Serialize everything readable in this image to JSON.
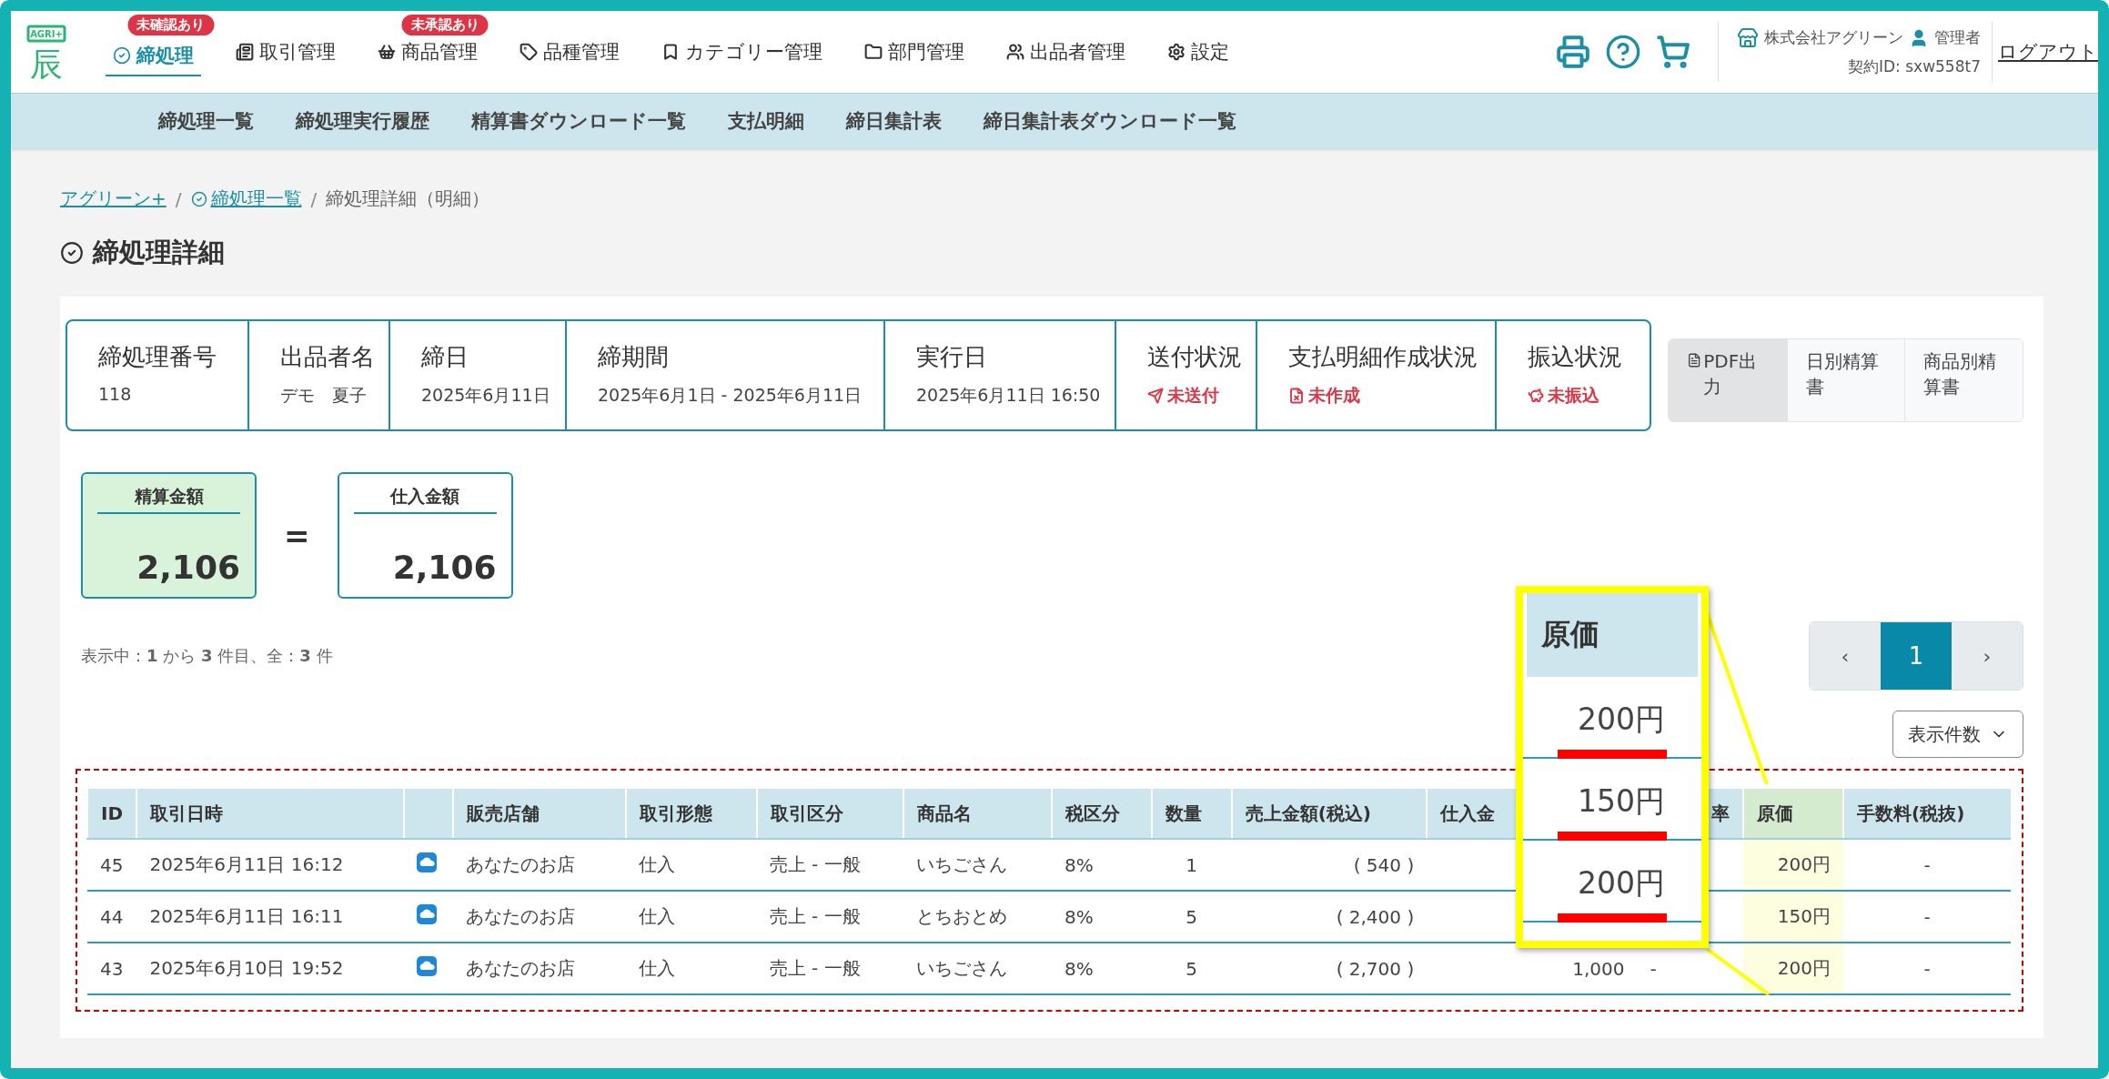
{
  "logo": {
    "top": "AGRI+",
    "bottom": "辰"
  },
  "nav": [
    {
      "label": "締処理",
      "selected": true,
      "badge": "未確認あり"
    },
    {
      "label": "取引管理",
      "selected": false
    },
    {
      "label": "商品管理",
      "selected": false,
      "badge": "未承認あり"
    },
    {
      "label": "品種管理",
      "selected": false
    },
    {
      "label": "カテゴリー管理",
      "selected": false
    },
    {
      "label": "部門管理",
      "selected": false
    },
    {
      "label": "出品者管理",
      "selected": false
    },
    {
      "label": "設定",
      "selected": false
    }
  ],
  "account": {
    "company": "株式会社アグリーン",
    "role": "管理者",
    "contract": "契約ID: sxw558t7",
    "logout": "ログアウト"
  },
  "subnav": [
    "締処理一覧",
    "締処理実行履歴",
    "精算書ダウンロード一覧",
    "支払明細",
    "締日集計表",
    "締日集計表ダウンロード一覧"
  ],
  "breadcrumb": [
    {
      "label": "アグリーン+",
      "link": true
    },
    {
      "label": "締処理一覧",
      "link": true
    },
    {
      "label": "締処理詳細（明細）",
      "link": false
    }
  ],
  "breadcrumb_separator": "/",
  "title": "締処理詳細",
  "info": [
    {
      "label": "締処理番号",
      "value": "118",
      "kind": "plain"
    },
    {
      "label": "出品者名",
      "value": "デモ　夏子",
      "kind": "plain"
    },
    {
      "label": "締日",
      "value": "2025年6月11日",
      "kind": "plain"
    },
    {
      "label": "締期間",
      "value": "2025年6月1日 - 2025年6月11日",
      "kind": "plain"
    },
    {
      "label": "実行日",
      "value": "2025年6月11日 16:50",
      "kind": "plain"
    },
    {
      "label": "送付状況",
      "value": "未送付",
      "kind": "alert"
    },
    {
      "label": "支払明細作成状況",
      "value": "未作成",
      "kind": "alert"
    },
    {
      "label": "振込状況",
      "value": "未振込",
      "kind": "alert"
    }
  ],
  "actions": [
    {
      "label": "PDF出力",
      "selected": true
    },
    {
      "label": "日別精算書",
      "selected": false
    },
    {
      "label": "商品別精算書",
      "selected": false
    }
  ],
  "summary": [
    {
      "label": "精算金額",
      "value": "2,106",
      "kind": "highlight"
    },
    {
      "label": "仕入金額",
      "value": "2,106",
      "kind": "plain"
    }
  ],
  "summary_operator": "=",
  "count_text": "表示中：**1** から **3** 件目、全：**3** 件",
  "pagination": {
    "prev": "‹",
    "pages": [
      {
        "label": "1",
        "selected": true
      }
    ],
    "next": "›"
  },
  "page_size": "表示件数",
  "table": {
    "columns": [
      "ID",
      "取引日時",
      "",
      "販売店舗",
      "取引形態",
      "取引区分",
      "商品名",
      "税区分",
      "数量",
      "売上金額(税込)",
      "仕入金",
      "率",
      "原価",
      "手数料(税抜)"
    ],
    "rows": [
      {
        "id": "45",
        "datetime": "2025年6月11日 16:12",
        "store": "あなたのお店",
        "form": "仕入",
        "category": "売上 - 一般",
        "product": "いちごさん",
        "tax": "8%",
        "qty": "1",
        "sales": "( 540 )",
        "cost": "200円",
        "fee": "-"
      },
      {
        "id": "44",
        "datetime": "2025年6月11日 16:11",
        "store": "あなたのお店",
        "form": "仕入",
        "category": "売上 - 一般",
        "product": "とちおとめ",
        "tax": "8%",
        "qty": "5",
        "sales": "( 2,400 )",
        "cost": "150円",
        "fee": "-"
      },
      {
        "id": "43",
        "datetime": "2025年6月10日 19:52",
        "store": "あなたのお店",
        "form": "仕入",
        "category": "売上 - 一般",
        "product": "いちごさん",
        "tax": "8%",
        "qty": "5",
        "sales": "( 2,700 )",
        "purchase": "1,000",
        "rate": "-",
        "cost": "200円",
        "fee": "-"
      }
    ]
  },
  "callout": {
    "header": "原価",
    "values": [
      "200円",
      "150円",
      "200円"
    ]
  }
}
